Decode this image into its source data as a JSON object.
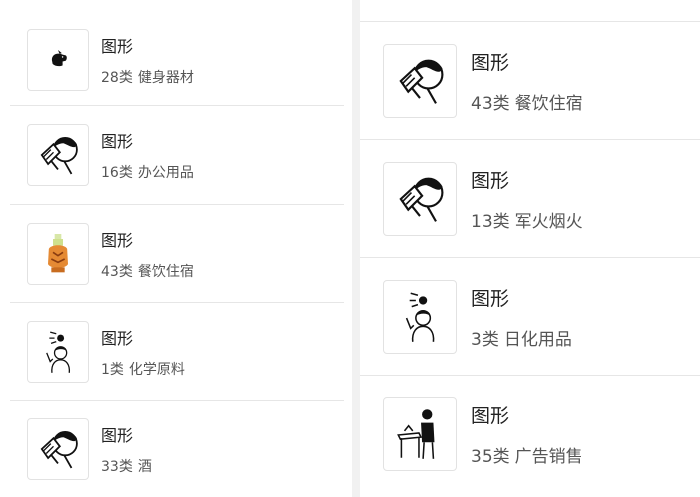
{
  "left_items": [
    {
      "title": "图形",
      "count": "28类",
      "category": "健身器材",
      "icon": "dog-icon"
    },
    {
      "title": "图形",
      "count": "16类",
      "category": "办公用品",
      "icon": "person-drinking-icon"
    },
    {
      "title": "图形",
      "count": "43类",
      "category": "餐饮住宿",
      "icon": "bottle-tiger-icon"
    },
    {
      "title": "图形",
      "count": "1类",
      "category": "化学原料",
      "icon": "person-thinking-icon"
    },
    {
      "title": "图形",
      "count": "33类",
      "category": "酒",
      "icon": "person-drinking-icon"
    }
  ],
  "right_items": [
    {
      "title": "图形",
      "count": "43类",
      "category": "餐饮住宿",
      "icon": "person-drinking-icon"
    },
    {
      "title": "图形",
      "count": "13类",
      "category": "军火烟火",
      "icon": "person-drinking-icon"
    },
    {
      "title": "图形",
      "count": "3类",
      "category": "日化用品",
      "icon": "person-thinking-icon"
    },
    {
      "title": "图形",
      "count": "35类",
      "category": "广告销售",
      "icon": "person-table-icon"
    }
  ]
}
